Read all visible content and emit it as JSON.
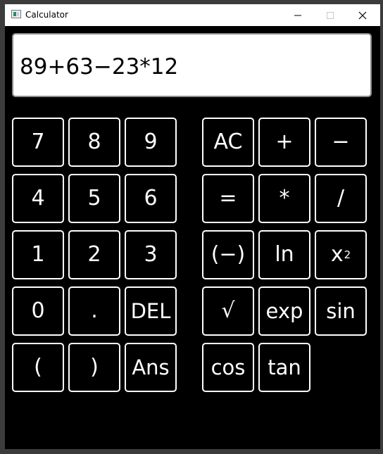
{
  "window": {
    "title": "Calculator",
    "minimize_icon": "minimize-icon",
    "maximize_icon": "maximize-icon",
    "close_icon": "close-icon"
  },
  "display": {
    "expression": "89+63−23*12"
  },
  "keys": {
    "k7": "7",
    "k8": "8",
    "k9": "9",
    "ac": "AC",
    "plus": "+",
    "minus": "−",
    "k4": "4",
    "k5": "5",
    "k6": "6",
    "equals": "=",
    "multiply": "*",
    "divide": "/",
    "k1": "1",
    "k2": "2",
    "k3": "3",
    "negate": "(−)",
    "ln": "ln",
    "square_base": "x",
    "square_exp": "2",
    "k0": "0",
    "dot": ".",
    "del": "DEL",
    "sqrt": "√",
    "exp": "exp",
    "sin": "sin",
    "lparen": "(",
    "rparen": ")",
    "ans": "Ans",
    "cos": "cos",
    "tan": "tan"
  }
}
